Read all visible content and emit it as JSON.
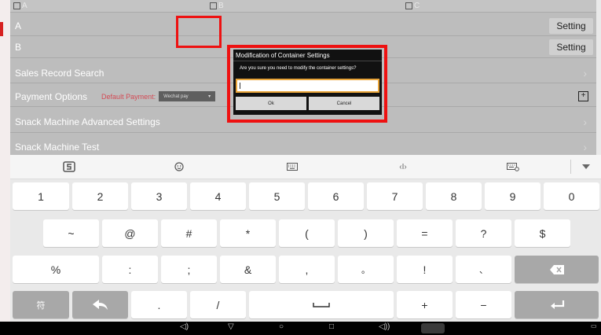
{
  "app": {
    "checkbox_labels": [
      "A",
      "B",
      "C"
    ],
    "rows": [
      {
        "label": "A",
        "action": "Setting"
      },
      {
        "label": "B",
        "action": "Setting"
      },
      {
        "label": "Sales Record Search"
      },
      {
        "label": "Payment Options",
        "default_label": "Default Payment:",
        "default_value": "Wechat pay"
      },
      {
        "label": "Snack Machine Advanced Settings"
      },
      {
        "label": "Snack Machine Test"
      }
    ]
  },
  "dialog": {
    "title": "Modification of Container Settings",
    "message": "Are you sure you need to modify the container settings?",
    "input_value": "",
    "ok_label": "Ok",
    "cancel_label": "Cancel"
  },
  "keyboard": {
    "toolbar_icons": [
      "swype-logo-icon",
      "emoji-icon",
      "keyboard-layout-icon",
      "cursor-move-icon",
      "keyboard-settings-icon",
      "hide-keyboard-icon"
    ],
    "row1": [
      "1",
      "2",
      "3",
      "4",
      "5",
      "6",
      "7",
      "8",
      "9",
      "0"
    ],
    "row2": [
      "~",
      "@",
      "#",
      "*",
      "(",
      ")",
      "=",
      "?",
      "$"
    ],
    "row3": [
      "%",
      ":",
      ";",
      "&",
      ",",
      "。",
      "!",
      "、"
    ],
    "row4": {
      "symbol_key": "符",
      "period": ".",
      "slash": "/",
      "plus": "+",
      "minus": "−"
    }
  },
  "colors": {
    "highlight": "#e11111",
    "input_focus": "#e9a53a",
    "payment_default": "#d34b55"
  }
}
